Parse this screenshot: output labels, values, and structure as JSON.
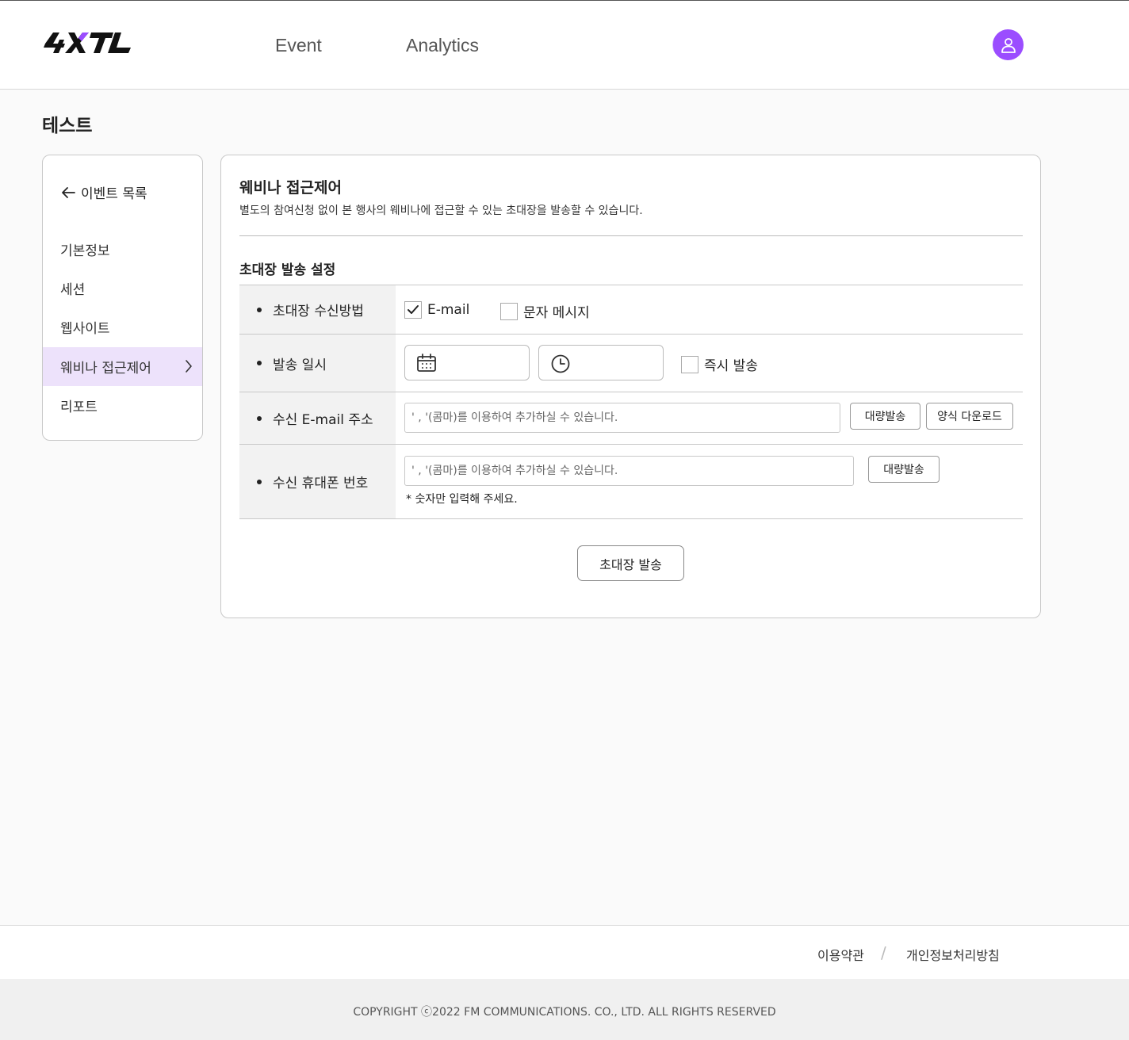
{
  "header": {
    "logo_text": "4XTL",
    "nav": [
      {
        "label": "Event"
      },
      {
        "label": "Analytics"
      }
    ],
    "avatar_icon": "user-icon",
    "accent_color": "#9b4dff"
  },
  "page": {
    "title": "테스트"
  },
  "sidebar": {
    "back_label": "이벤트 목록",
    "items": [
      {
        "label": "기본정보"
      },
      {
        "label": "세션"
      },
      {
        "label": "웹사이트"
      },
      {
        "label": "웨비나 접근제어",
        "active": true
      },
      {
        "label": "리포트"
      }
    ],
    "active_bg": "#ede2fb"
  },
  "panel": {
    "title": "웨비나 접근제어",
    "description": "별도의 참여신청 없이 본 행사의 웨비나에 접근할 수 있는 초대장을 발송할 수 있습니다.",
    "section_title": "초대장 발송 설정",
    "rows": {
      "method": {
        "label": "초대장 수신방법",
        "options": [
          {
            "label": "E-mail",
            "checked": true
          },
          {
            "label": "문자 메시지",
            "checked": false
          }
        ]
      },
      "schedule": {
        "label": "발송 일시",
        "date_value": "",
        "time_value": "",
        "immediate_label": "즉시 발송",
        "immediate_checked": false
      },
      "email": {
        "label": "수신 E-mail 주소",
        "placeholder": "' , '(콤마)를 이용하여 추가하실 수 있습니다.",
        "bulk_button": "대량발송",
        "template_button": "양식 다운로드"
      },
      "phone": {
        "label": "수신 휴대폰 번호",
        "placeholder": "' , '(콤마)를 이용하여 추가하실 수 있습니다.",
        "bulk_button": "대량발송",
        "hint": "* 숫자만 입력해 주세요."
      }
    },
    "submit_label": "초대장 발송"
  },
  "footer": {
    "terms": "이용약관",
    "separator": "/",
    "privacy": "개인정보처리방침",
    "copyright": "COPYRIGHT ⓒ2022  FM COMMUNICATIONS. CO., LTD. ALL RIGHTS RESERVED"
  }
}
